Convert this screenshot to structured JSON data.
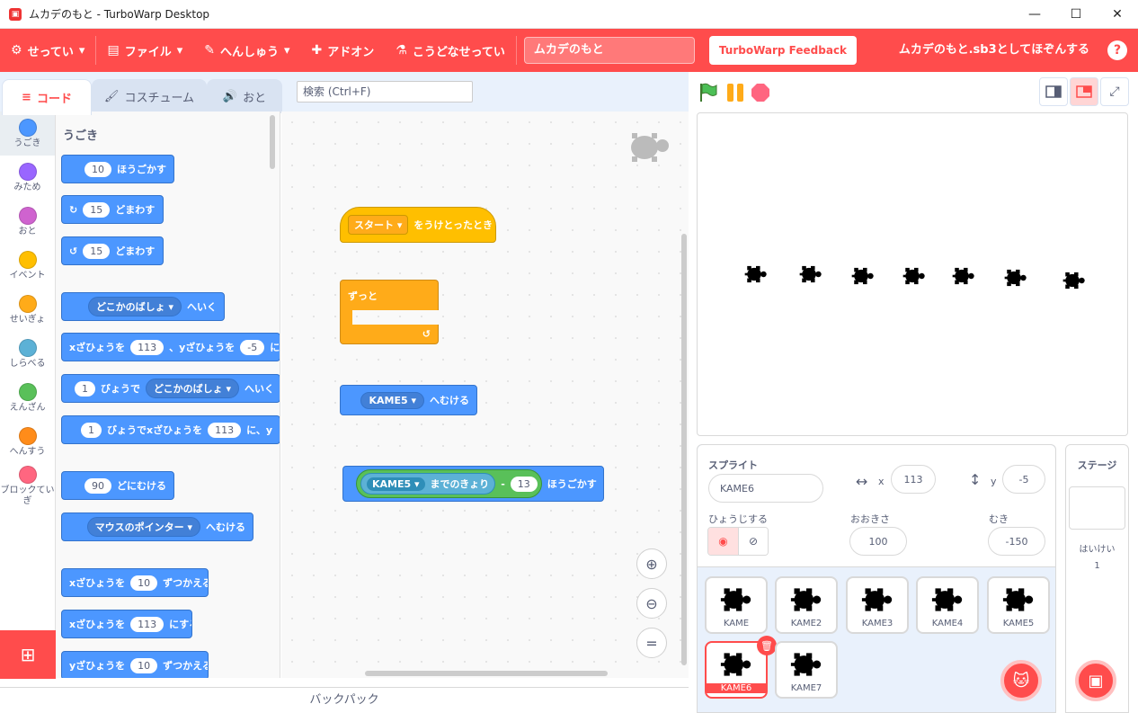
{
  "window": {
    "title": "ムカデのもと - TurboWarp Desktop",
    "min": "—",
    "max": "☐",
    "close": "✕"
  },
  "menu": {
    "settings": "せってい",
    "file": "ファイル",
    "edit": "へんしゅう",
    "addons": "アドオン",
    "howto": "こうどなせってい",
    "project_title": "ムカデのもと",
    "feedback": "TurboWarp Feedback",
    "save": "ムカデのもと.sb3としてほぞんする",
    "help": "?"
  },
  "tabs": {
    "code": "コード",
    "costume": "コスチューム",
    "sound": "おと"
  },
  "search": {
    "placeholder": "検索 (Ctrl+F)"
  },
  "categories": [
    {
      "label": "うごき",
      "color": "#4c97ff"
    },
    {
      "label": "みため",
      "color": "#9966ff"
    },
    {
      "label": "おと",
      "color": "#cf63cf"
    },
    {
      "label": "イベント",
      "color": "#ffbf00"
    },
    {
      "label": "せいぎょ",
      "color": "#ffab19"
    },
    {
      "label": "しらべる",
      "color": "#5cb1d6"
    },
    {
      "label": "えんざん",
      "color": "#59c059"
    },
    {
      "label": "へんすう",
      "color": "#ff8c1a"
    },
    {
      "label": "ブロックていぎ",
      "color": "#ff6680"
    }
  ],
  "palette": {
    "heading": "うごき",
    "b1": {
      "v": "10",
      "t": "ほうごかす"
    },
    "b2": {
      "v": "15",
      "t": "どまわす"
    },
    "b3": {
      "v": "15",
      "t": "どまわす"
    },
    "b4": {
      "d": "どこかのばしょ",
      "t": "へいく"
    },
    "b5": {
      "a": "xざひょうを",
      "x": "113",
      "b": "、yざひょうを",
      "y": "-5",
      "c": "にする"
    },
    "b6": {
      "v": "1",
      "a": "びょうで",
      "d": "どこかのばしょ",
      "c": "へいく"
    },
    "b7": {
      "v": "1",
      "a": "びょうでxざひょうを",
      "x": "113",
      "c": "に、y"
    },
    "b8": {
      "v": "90",
      "t": "どにむける"
    },
    "b9": {
      "d": "マウスのポインター",
      "t": "へむける"
    },
    "b10": {
      "a": "xざひょうを",
      "v": "10",
      "t": "ずつかえる"
    },
    "b11": {
      "a": "xざひょうを",
      "v": "113",
      "t": "にする"
    },
    "b12": {
      "a": "yざひょうを",
      "v": "10",
      "t": "ずつかえる"
    }
  },
  "workspace": {
    "hat": {
      "d": "スタート",
      "t": "をうけとったとき"
    },
    "forever": "ずっと",
    "point": {
      "d": "KAME5",
      "t": "へむける"
    },
    "move": {
      "d": "KAME5",
      "dist": "までのきょり",
      "op": "-",
      "v": "13",
      "t": "ほうごかす"
    }
  },
  "sprite_info": {
    "sprite_label": "スプライト",
    "name": "KAME6",
    "x_label": "x",
    "x": "113",
    "y_label": "y",
    "y": "-5",
    "show_label": "ひょうじする",
    "size_label": "おおきさ",
    "size": "100",
    "dir_label": "むき",
    "direction": "-150"
  },
  "sprites": [
    "KAME",
    "KAME2",
    "KAME3",
    "KAME4",
    "KAME5",
    "KAME6",
    "KAME7"
  ],
  "selected_sprite": "KAME6",
  "stage_pane": {
    "label": "ステージ",
    "backdrops_label": "はいけい",
    "backdrops": "1"
  },
  "backpack": "バックパック",
  "colors": {
    "accent": "#ff4c4c",
    "motion": "#4c97ff",
    "events": "#ffbf00",
    "control": "#ffab19"
  }
}
